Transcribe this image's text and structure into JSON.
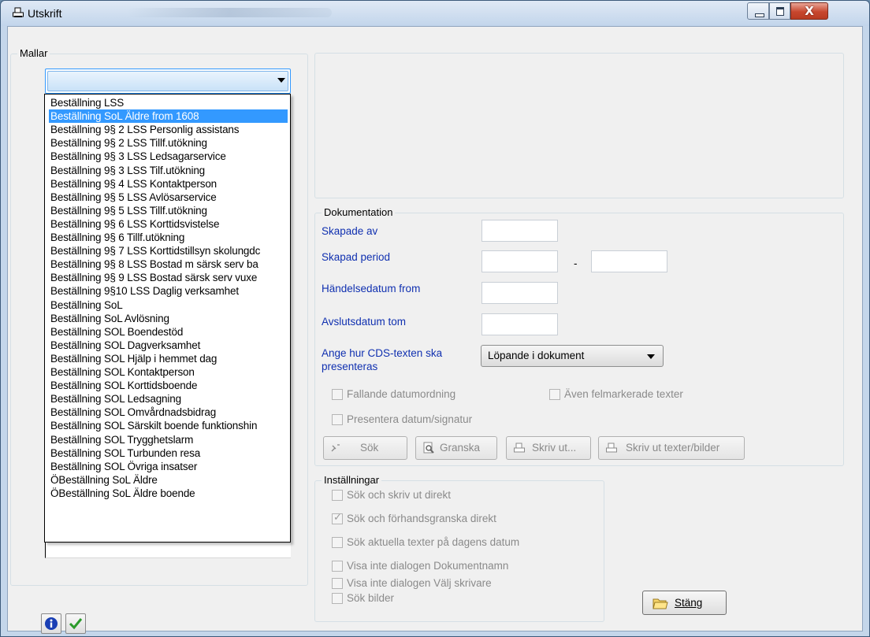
{
  "window": {
    "title": "Utskrift",
    "icons": {
      "app": "printer-icon",
      "minimize": "minimize-icon",
      "maximize": "maximize-icon",
      "close": "close-icon"
    },
    "close_glyph": "X"
  },
  "templates": {
    "group_label": "Mallar",
    "combo_value": "",
    "items": [
      "Beställning LSS",
      "Beställning SoL Äldre from 1608",
      "Beställning 9§ 2 LSS Personlig assistans",
      "Beställning 9§ 2 LSS Tillf.utökning",
      "Beställning 9§ 3 LSS Ledsagarservice",
      "Beställning 9§ 3 LSS Tilf.utökning",
      "Beställning 9§ 4 LSS Kontaktperson",
      "Beställning 9§ 5 LSS Avlösarservice",
      "Beställning 9§ 5 LSS Tillf.utökning",
      "Beställning 9§ 6 LSS Korttidsvistelse",
      "Beställning 9§ 6 Tillf.utökning",
      "Beställning 9§ 7 LSS Korttidstillsyn skolungdc",
      "Beställning 9§ 8 LSS Bostad m särsk serv ba",
      "Beställning 9§ 9 LSS Bostad särsk serv vuxe",
      "Beställning 9§10 LSS Daglig verksamhet",
      "Beställning SoL",
      "Beställning SoL Avlösning",
      "Beställning SOL Boendestöd",
      "Beställning SOL Dagverksamhet",
      "Beställning SOL Hjälp i hemmet dag",
      "Beställning SOL Kontaktperson",
      "Beställning SOL Korttidsboende",
      "Beställning SOL Ledsagning",
      "Beställning SOL Omvårdnadsbidrag",
      "Beställning SOL Särskilt boende funktionshin",
      "Beställning SOL Trygghetslarm",
      "Beställning SOL Turbunden resa",
      "Beställning SOL Övriga insatser",
      "ÖBeställning SoL Äldre",
      "ÖBeställning SoL Äldre boende"
    ],
    "selected_index": 1
  },
  "documentation": {
    "group_label": "Dokumentation",
    "created_by_label": "Skapade av",
    "created_period_label": "Skapad period",
    "period_separator": "-",
    "event_date_label": "Händelsedatum from",
    "end_date_label": "Avslutsdatum tom",
    "cds_label_line1": "Ange hur CDS-texten ska",
    "cds_label_line2": "presenteras",
    "cds_value": "Löpande i dokument",
    "desc_date_order": "Fallande datumordning",
    "include_marked": "Även felmarkerade texter",
    "present_date_sign": "Presentera datum/signatur",
    "buttons": {
      "search": "Sök",
      "preview": "Granska",
      "print": "Skriv ut...",
      "print_texts": "Skriv ut texter/bilder"
    }
  },
  "settings": {
    "group_label": "Inställningar",
    "options": [
      {
        "label": "Sök och skriv ut direkt",
        "checked": false
      },
      {
        "label": "Sök och förhandsgranska direkt",
        "checked": true
      },
      {
        "label": "Sök aktuella texter på dagens datum",
        "checked": false
      },
      {
        "label": "Visa inte dialogen Dokumentnamn",
        "checked": false
      },
      {
        "label": "Visa inte dialogen Välj skrivare",
        "checked": false
      },
      {
        "label": "Sök bilder",
        "checked": false
      }
    ]
  },
  "footer": {
    "info_icon": "info-icon",
    "ok_icon": "checkmark-icon",
    "close_label": "Stäng",
    "close_icon": "folder-icon"
  },
  "colors": {
    "accent": "#3399ff",
    "label_blue": "#1030b0",
    "disabled": "#8a8a8a"
  }
}
